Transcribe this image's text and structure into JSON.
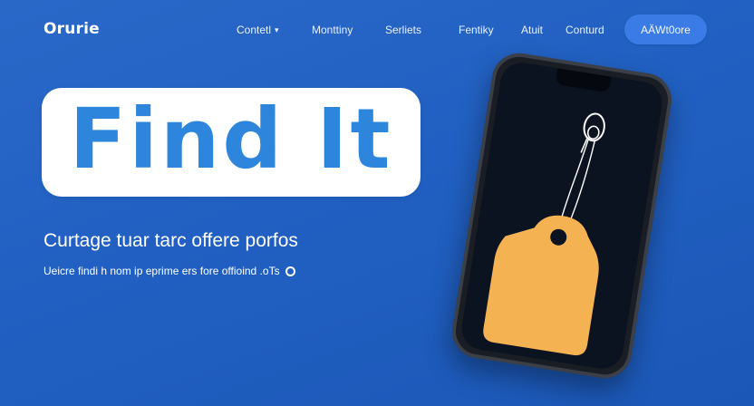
{
  "brand": {
    "logo": "Orurie"
  },
  "nav": {
    "items": [
      {
        "label": "Contetl",
        "has_dropdown": true
      },
      {
        "label": "Monttiny"
      },
      {
        "label": "Serliets"
      },
      {
        "label": "Fentiky"
      },
      {
        "label": "Atuit"
      },
      {
        "label": "Conturd"
      }
    ],
    "cta_label": "AÄWt0ore"
  },
  "hero": {
    "title": "Find It",
    "subtitle": "Curtage tuar tarc offere porfos",
    "body": "Ueicre findi h nom ip eprime ers fore offioind .oTs"
  },
  "colors": {
    "background": "#2160c2",
    "title_text": "#2d86dc",
    "tag": "#f5b253",
    "screen": "#0b1220"
  },
  "icons": {
    "info": "circle-icon",
    "nav_dropdown": "chevron-down-icon"
  }
}
